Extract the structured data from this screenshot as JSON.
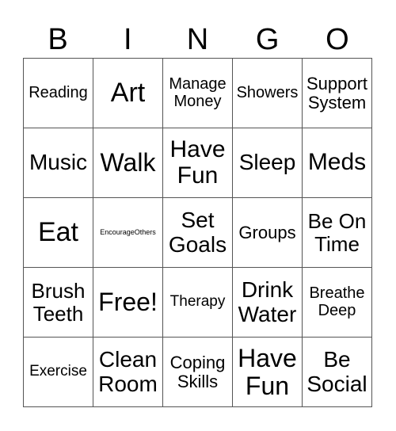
{
  "header": {
    "letters": [
      "B",
      "I",
      "N",
      "G",
      "O"
    ]
  },
  "cells": [
    [
      "Reading",
      "Art",
      "Manage\nMoney",
      "Showers",
      "Support\nSystem"
    ],
    [
      "Music",
      "Walk",
      "Have\nFun",
      "Sleep",
      "Meds"
    ],
    [
      "Eat",
      "EncourageOthers",
      "Set\nGoals",
      "Groups",
      "Be On\nTime"
    ],
    [
      "Brush\nTeeth",
      "Free!",
      "Therapy",
      "Drink\nWater",
      "Breathe\nDeep"
    ],
    [
      "Exercise",
      "Clean\nRoom",
      "Coping\nSkills",
      "Have\nFun",
      "Be\nSocial"
    ]
  ]
}
